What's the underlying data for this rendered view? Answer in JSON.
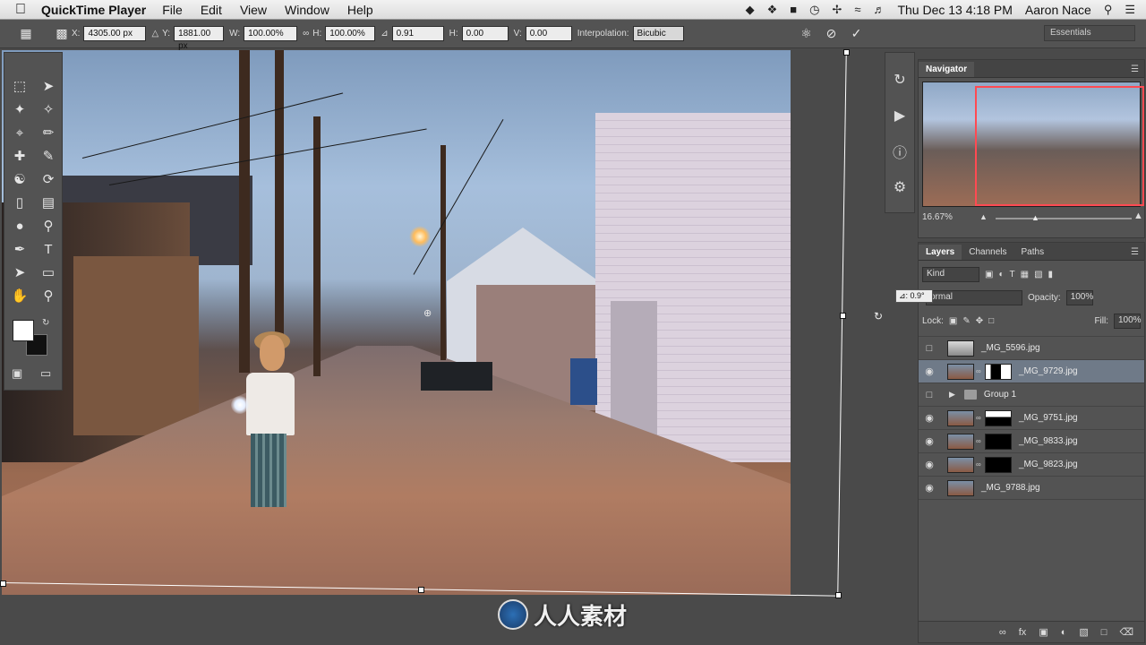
{
  "menubar": {
    "app": "QuickTime Player",
    "menus": [
      "File",
      "Edit",
      "View",
      "Window",
      "Help"
    ],
    "clock": "Thu Dec 13  4:18 PM",
    "user": "Aaron Nace"
  },
  "options": {
    "x_label": "X:",
    "x_value": "4305.00 px",
    "y_label": "Y:",
    "y_value": "1881.00 px",
    "w_label": "W:",
    "w_value": "100.00%",
    "h_label": "H:",
    "h_value": "100.00%",
    "angle_value": "0.91",
    "hskew_label": "H:",
    "hskew_value": "0.00",
    "vskew_label": "V:",
    "vskew_value": "0.00",
    "interp_label": "Interpolation:",
    "interp_value": "Bicubic",
    "workspace": "Essentials"
  },
  "canvas": {
    "angle_tooltip": "⊿: 0.9°"
  },
  "navigator": {
    "tab": "Navigator",
    "zoom": "16.67%"
  },
  "layers_panel": {
    "tabs": [
      "Layers",
      "Channels",
      "Paths"
    ],
    "kind": "Kind",
    "blend_mode": "ormal",
    "opacity_label": "Opacity:",
    "opacity_value": "100%",
    "lock_label": "Lock:",
    "fill_label": "Fill:",
    "fill_value": "100%",
    "layers": [
      {
        "name": "_MG_5596.jpg"
      },
      {
        "name": "_MG_9729.jpg"
      },
      {
        "name": "Group 1"
      },
      {
        "name": "_MG_9751.jpg"
      },
      {
        "name": "_MG_9833.jpg"
      },
      {
        "name": "_MG_9823.jpg"
      },
      {
        "name": "_MG_9788.jpg"
      }
    ]
  },
  "watermark": {
    "text": "人人素材"
  }
}
